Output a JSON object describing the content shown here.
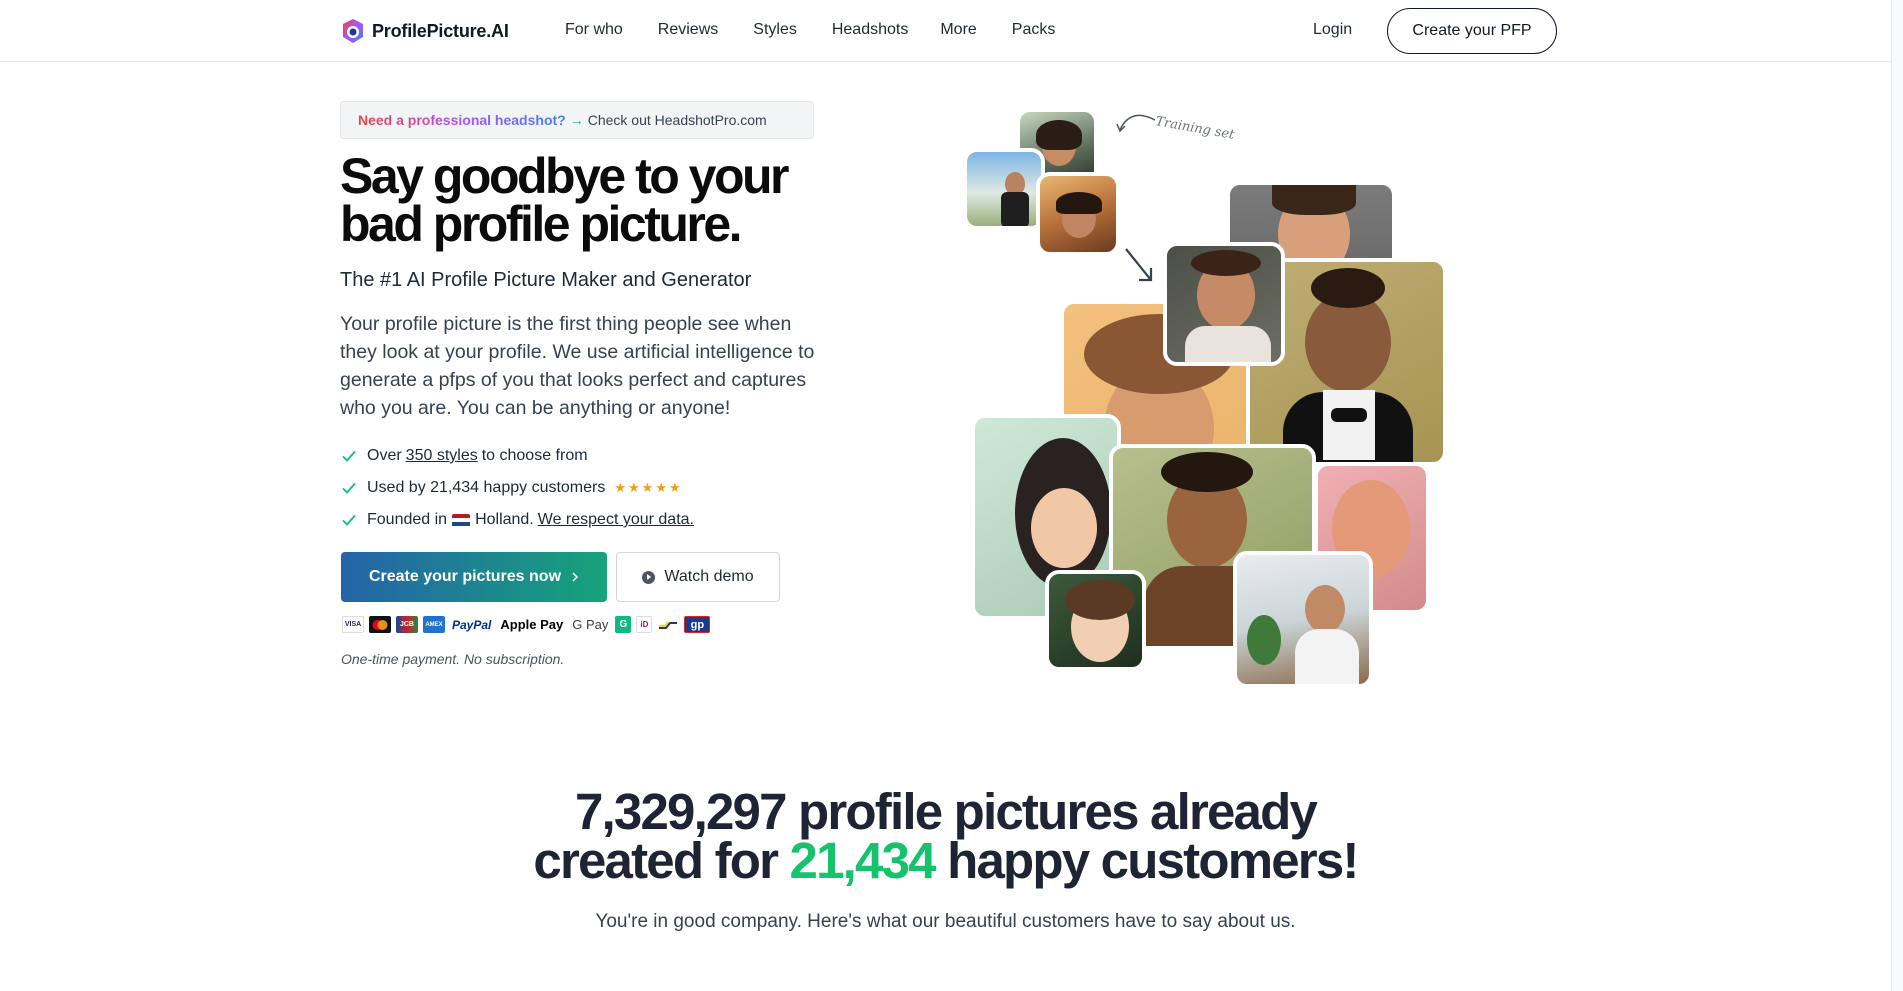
{
  "brand": {
    "name": "ProfilePicture.AI"
  },
  "nav": {
    "items": [
      "For who",
      "Reviews",
      "Styles",
      "Headshots",
      "More",
      "Packs"
    ],
    "login": "Login",
    "cta": "Create your PFP"
  },
  "notice": {
    "highlight": "Need a professional headshot?",
    "arrow": "→",
    "text": "Check out HeadshotPro.com"
  },
  "hero": {
    "title": "Say goodbye to your bad profile picture.",
    "subtitle": "The #1 AI Profile Picture Maker and Generator",
    "description": "Your profile picture is the first thing people see when they look at your profile. We use artificial intelligence to generate a pfps of you that looks perfect and captures who you are. You can be anything or anyone!",
    "features": {
      "f1_pre": "Over",
      "f1_link": "350 styles",
      "f1_post": "to choose from",
      "f2": "Used by 21,434 happy customers",
      "f2_stars": "★★★★★",
      "f3_pre": "Founded in",
      "f3_mid": "Holland.",
      "f3_link": "We respect your data."
    },
    "primary_button": "Create your pictures now",
    "secondary_button": "Watch demo",
    "payment_note": "One-time payment. No subscription.",
    "payment_methods": [
      "VISA",
      "Mastercard",
      "JCB",
      "AMEX",
      "PayPal",
      "Apple Pay",
      "G Pay",
      "G",
      "iD",
      "Bancontact",
      "gp"
    ],
    "training_label": "Training set"
  },
  "stats": {
    "count": "7,329,297",
    "line1_rest": "profile pictures already",
    "line2_pre": "created for",
    "customers": "21,434",
    "line2_post": "happy customers!",
    "subtitle": "You're in good company. Here's what our beautiful customers have to say about us."
  },
  "colors": {
    "accent_green": "#16c26b",
    "button_gradient_start": "#2563a8",
    "button_gradient_end": "#16a37a",
    "star": "#f59e0b"
  }
}
